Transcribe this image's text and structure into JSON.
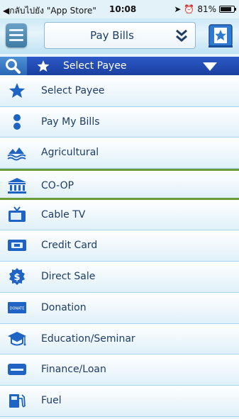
{
  "status_bar": {
    "back_label": "◀กลับไปยัง \"App Store\"",
    "time": "10:08",
    "battery_percent": "81%",
    "battery_level": 0.81
  },
  "header": {
    "title": "Pay Bills",
    "menu_icon": "hamburger-icon",
    "favorite_icon": "star-bookmark-icon"
  },
  "select_bar": {
    "label": "Select Payee",
    "search_icon": "search-icon",
    "star_icon": "star-icon",
    "dropdown_icon": "caret-down-icon"
  },
  "list": [
    {
      "label": "Select Payee",
      "icon": "star-icon"
    },
    {
      "label": "Pay My Bills",
      "icon": "bills-icon"
    },
    {
      "label": "Agricultural",
      "icon": "agriculture-icon"
    },
    {
      "label": "CO-OP",
      "icon": "bank-icon",
      "selected": true
    },
    {
      "label": "Cable TV",
      "icon": "tv-icon"
    },
    {
      "label": "Credit Card",
      "icon": "credit-card-icon"
    },
    {
      "label": "Direct Sale",
      "icon": "dollar-icon"
    },
    {
      "label": "Donation",
      "icon": "donate-icon"
    },
    {
      "label": "Education/Seminar",
      "icon": "graduation-icon"
    },
    {
      "label": "Finance/Loan",
      "icon": "card-icon"
    },
    {
      "label": "Fuel",
      "icon": "fuel-icon"
    }
  ],
  "donate_badge_text": "DONATE",
  "colors": {
    "accent": "#1b3f9f",
    "icon_blue": "#1f63c4",
    "text": "#1d3d67",
    "selected_border": "#6a9c3c"
  }
}
